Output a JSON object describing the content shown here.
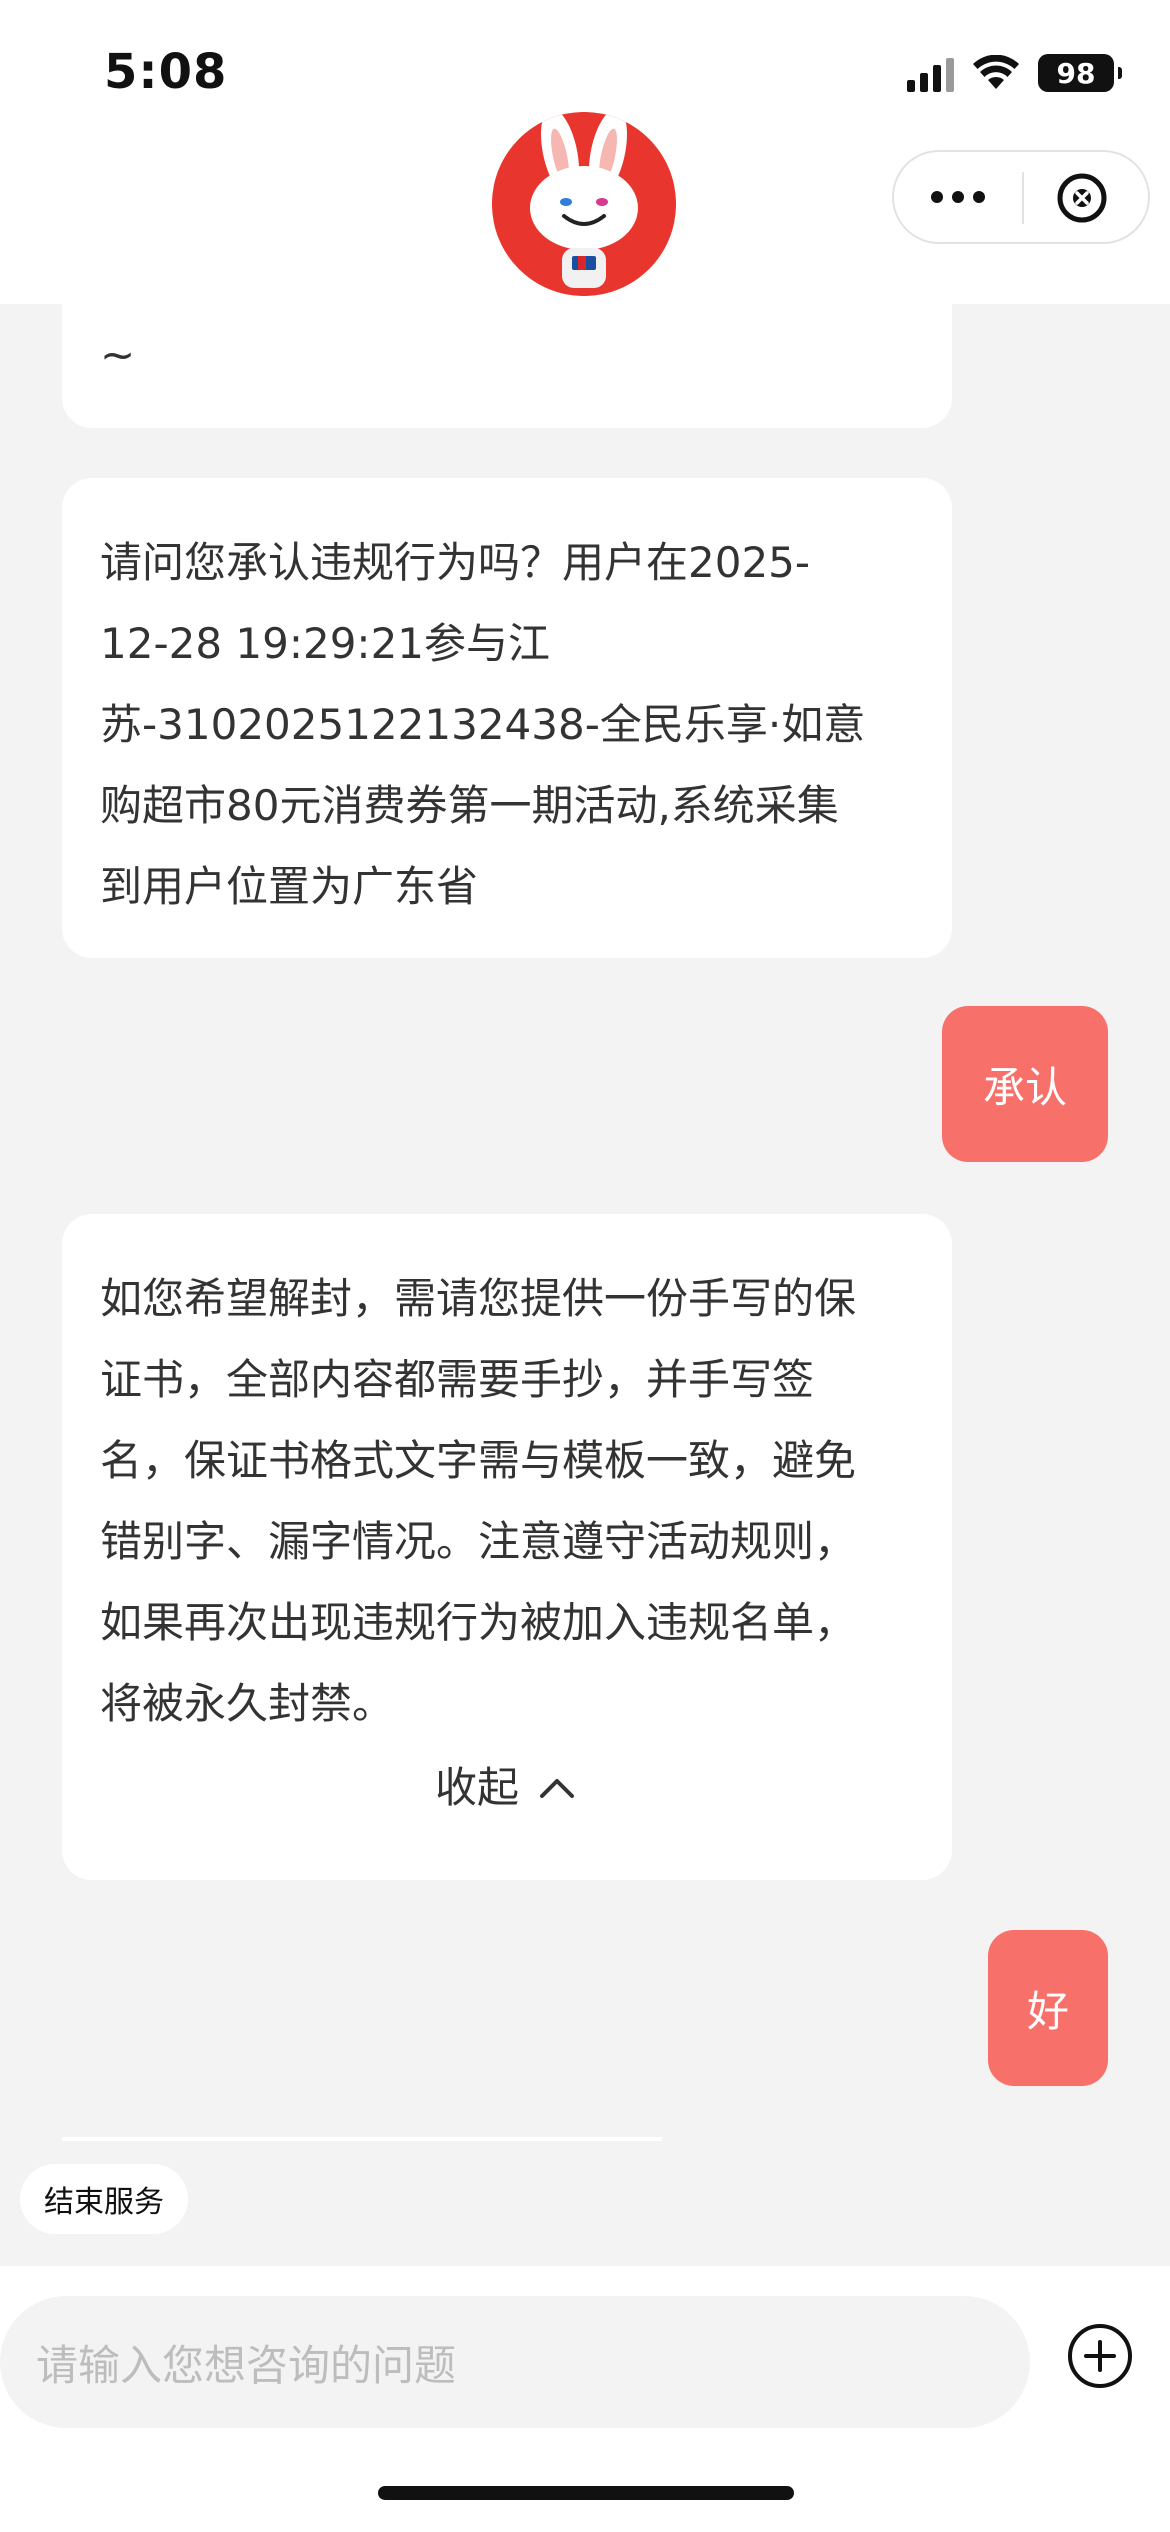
{
  "status_bar": {
    "time": "5:08",
    "battery": "98"
  },
  "header": {
    "avatar": "rabbit-mascot-avatar",
    "more_icon": "more-dots-icon",
    "close_icon": "close-circle-icon"
  },
  "messages": [
    {
      "from": "bot",
      "text": "~"
    },
    {
      "from": "bot",
      "lines": [
        "请问您承认违规行为吗？用户在2025-",
        "12-28 19:29:21参与江",
        "苏-3102025122132438-全民乐享·如意",
        "购超市80元消费券第一期活动,系统采集",
        "到用户位置为广东省"
      ]
    },
    {
      "from": "user",
      "text": "承认"
    },
    {
      "from": "bot",
      "lines": [
        "如您希望解封，需请您提供一份手写的保",
        "证书，全部内容都需要手抄，并手写签",
        "名，保证书格式文字需与模板一致，避免",
        "错别字、漏字情况。注意遵守活动规则，",
        "如果再次出现违规行为被加入违规名单，",
        "将被永久封禁。"
      ],
      "collapse_label": "收起"
    },
    {
      "from": "user",
      "text": "好"
    }
  ],
  "end_service_label": "结束服务",
  "input": {
    "placeholder": "请输入您想咨询的问题"
  },
  "colors": {
    "user_bubble": "#f8706a",
    "background": "#f3f3f3",
    "brand_red": "#e8352d"
  }
}
